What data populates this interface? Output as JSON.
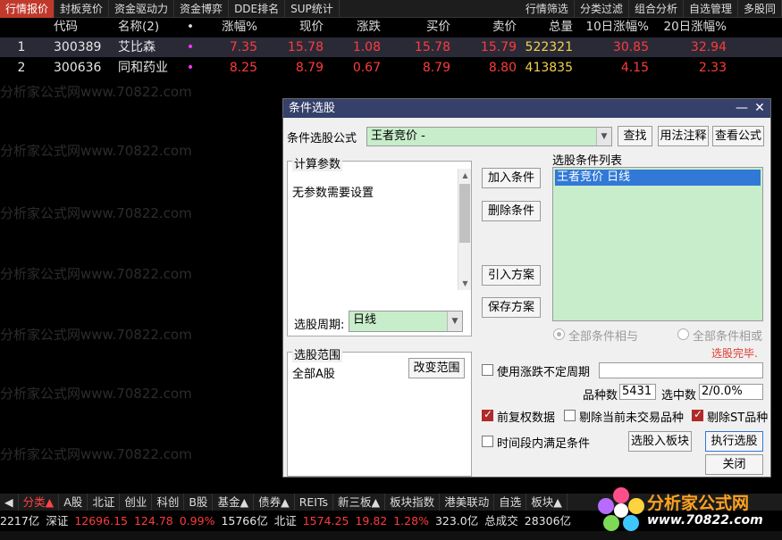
{
  "topbar": {
    "tabs": [
      "行情报价",
      "封板竞价",
      "资金驱动力",
      "资金博弈",
      "DDE排名",
      "SUP统计"
    ],
    "right_tabs": [
      "行情筛选",
      "分类过滤",
      "组合分析",
      "自选管理",
      "多股同"
    ]
  },
  "table": {
    "headers": [
      "代码",
      "名称(2)",
      "•",
      "涨幅%",
      "现价",
      "涨跌",
      "买价",
      "卖价",
      "总量",
      "10日涨幅%",
      "20日涨幅%"
    ],
    "rows": [
      {
        "idx": "1",
        "code": "300389",
        "name": "艾比森",
        "dot": "•",
        "pct": "7.35",
        "price": "15.78",
        "chg": "1.08",
        "bid": "15.78",
        "ask": "15.79",
        "vol": "522321",
        "d10": "30.85",
        "d20": "32.94"
      },
      {
        "idx": "2",
        "code": "300636",
        "name": "同和药业",
        "dot": "•",
        "pct": "8.25",
        "price": "8.79",
        "chg": "0.67",
        "bid": "8.79",
        "ask": "8.80",
        "vol": "413835",
        "d10": "4.15",
        "d20": "2.33"
      }
    ]
  },
  "watermark": "分析家公式网www.70822.com",
  "dialog": {
    "title": "条件选股",
    "minimize": "—",
    "close": "✕",
    "formula_label": "条件选股公式",
    "formula_value": "王者竞价  -",
    "find_button": "查找",
    "usage_button": "用法注释",
    "view_button": "查看公式",
    "params_group": "计算参数",
    "params_text": "无参数需要设置",
    "period_label": "选股周期:",
    "period_value": "日线",
    "add_cond": "加入条件",
    "del_cond": "删除条件",
    "import_plan": "引入方案",
    "save_plan": "保存方案",
    "cond_list_label": "选股条件列表",
    "cond_list_item": "王者竞价  日线",
    "radio_and": "全部条件相与",
    "radio_or": "全部条件相或",
    "status": "选股完毕.",
    "range_group": "选股范围",
    "range_value": "全部A股",
    "change_range": "改变范围",
    "use_uncertain": "使用涨跌不定周期",
    "count_label": "品种数",
    "count_value": "5431",
    "selected_label": "选中数",
    "selected_value": "2/0.0%",
    "fq_label": "前复权数据",
    "exclude_untraded": "剔除当前未交易品种",
    "exclude_st": "剔除ST品种",
    "time_cond": "时间段内满足条件",
    "to_block": "选股入板块",
    "run": "执行选股",
    "close_btn": "关闭"
  },
  "sectorbar": [
    "分类▲",
    "A股",
    "北证",
    "创业",
    "科创",
    "B股",
    "基金▲",
    "债券▲",
    "REITs",
    "新三板▲",
    "板块指数",
    "港美联动",
    "自选",
    "板块▲"
  ],
  "ticker": {
    "a": "2217亿",
    "sz_label": "深证",
    "sz_val": "12696.15",
    "sz_chg": "124.78",
    "sz_pct": "0.99%",
    "sz_amt": "15766亿",
    "bz_label": "北证",
    "bz_val": "1574.25",
    "bz_chg": "19.82",
    "bz_pct": "1.28%",
    "bz_amt": "323.0亿",
    "total_label": "总成交",
    "total_val": "28306亿"
  },
  "logo": {
    "name": "分析家公式网",
    "url": "www.70822.com"
  },
  "colors": {
    "up": "#ff3b3b",
    "volume": "#f3d34a",
    "title_bar": "#35406b",
    "selection": "#3178d7",
    "list_bg": "#c8edca"
  }
}
